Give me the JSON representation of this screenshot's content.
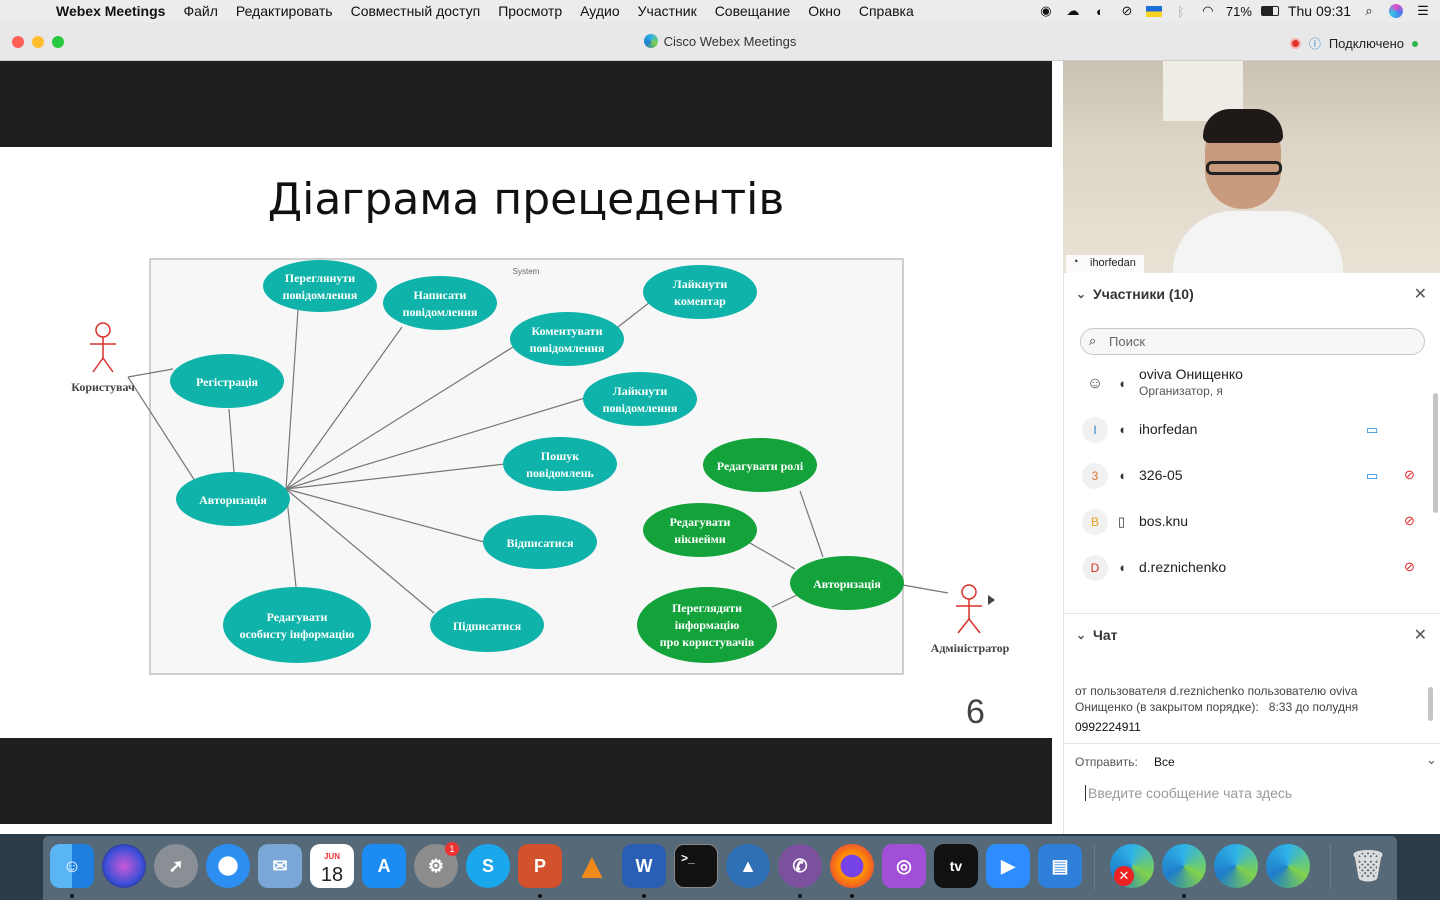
{
  "menubar": {
    "app_name": "Webex Meetings",
    "items": [
      "Файл",
      "Редактировать",
      "Совместный доступ",
      "Просмотр",
      "Аудио",
      "Участник",
      "Совещание",
      "Окно",
      "Справка"
    ],
    "battery": "71%",
    "clock": "Thu 09:31"
  },
  "window": {
    "title": "Cisco Webex Meetings",
    "status": "Подключено"
  },
  "slide": {
    "title": "Діаграма прецедентів",
    "page_number": "6",
    "system_label": "System",
    "actor_user": "Користувач",
    "actor_admin": "Адміністратор",
    "use_cases": {
      "view_messages": [
        "Переглянути",
        "повідомлення"
      ],
      "write_messages": [
        "Написати",
        "повідомлення"
      ],
      "like_comment": [
        "Лайкнути",
        "коментар"
      ],
      "comment_messages": [
        "Коментувати",
        "повідомлення"
      ],
      "registration": [
        "Регістрація"
      ],
      "like_messages": [
        "Лайкнути",
        "повідомлення"
      ],
      "search_messages": [
        "Пошук",
        "повідомлень"
      ],
      "authorization": [
        "Авторизація"
      ],
      "unsubscribe": [
        "Відписатися"
      ],
      "subscribe": [
        "Підписатися"
      ],
      "edit_personal": [
        "Редагувати",
        "особисту інформацію"
      ],
      "edit_roles": [
        "Редагувати ролі"
      ],
      "edit_nicknames": [
        "Редагувати",
        "нікнейми"
      ],
      "view_user_info": [
        "Переглядяти",
        "інформацію",
        "про користувачів"
      ],
      "admin_authorization": [
        "Авторизація"
      ]
    }
  },
  "video": {
    "participant_label": "ihorfedan"
  },
  "participants": {
    "header": "Участники (10)",
    "search_placeholder": "Поиск",
    "list": [
      {
        "avatar": "",
        "name": "oviva Онищенко",
        "role": "Организатор, я",
        "video": false,
        "muted": false
      },
      {
        "avatar": "I",
        "name": "ihorfedan",
        "role": "",
        "video": true,
        "muted": false
      },
      {
        "avatar": "3",
        "name": "326-05",
        "role": "",
        "video": true,
        "muted": true
      },
      {
        "avatar": "B",
        "name": "bos.knu",
        "role": "",
        "video": false,
        "muted": true
      },
      {
        "avatar": "D",
        "name": "d.reznichenko",
        "role": "",
        "video": false,
        "muted": true
      }
    ]
  },
  "chat": {
    "header": "Чат",
    "message_meta": "от пользователя d.reznichenko пользователю oviva Онищенко (в закрытом порядке):",
    "message_time": "8:33  до полудня",
    "message_text": "0992224911",
    "send_to_label": "Отправить:",
    "send_to_value": "Все",
    "compose_placeholder": "Введите сообщение чата здесь"
  },
  "dock": {
    "calendar_month": "JUN",
    "calendar_day": "18",
    "badge_count": "1",
    "apps": [
      "finder-icon",
      "siri-icon",
      "launchpad-icon",
      "safari-icon",
      "preview-icon",
      "calendar-icon",
      "app-store-icon",
      "system-preferences-icon",
      "skype-icon",
      "powerpoint-icon",
      "vlc-icon",
      "word-icon",
      "terminal-icon",
      "vpn-icon",
      "viber-icon",
      "firefox-icon",
      "podcasts-icon",
      "apple-tv-icon",
      "zoom-icon",
      "news-icon",
      "webex-icon",
      "webex-icon",
      "webex-icon",
      "webex-icon",
      "trash-icon"
    ]
  },
  "colors": {
    "use_case_teal": "#0fb3a9",
    "use_case_green": "#14a33b",
    "actor_red": "#d9302b",
    "accent_blue": "#1b87d9",
    "connected_green": "#2db54a"
  }
}
